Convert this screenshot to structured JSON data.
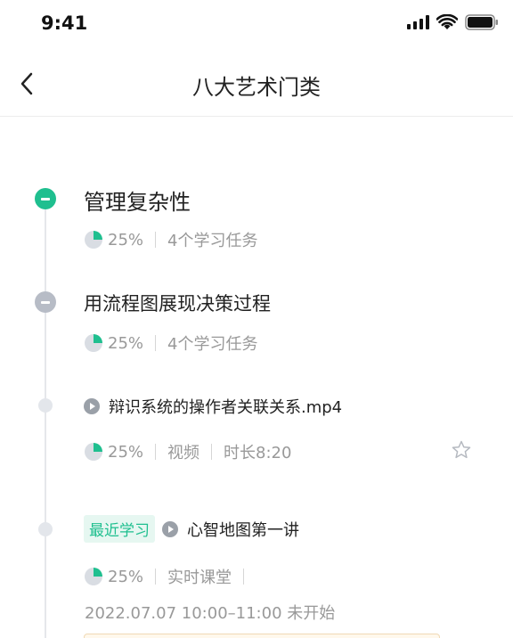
{
  "status": {
    "time": "9:41"
  },
  "nav": {
    "title": "八大艺术门类"
  },
  "sections": [
    {
      "title": "管理复杂性",
      "progress": "25%",
      "tasks": "4个学习任务"
    },
    {
      "title": "用流程图展现决策过程",
      "progress": "25%",
      "tasks": "4个学习任务"
    }
  ],
  "video": {
    "title": "辩识系统的操作者关联关系.mp4",
    "progress": "25%",
    "type": "视频",
    "duration": "时长8:20"
  },
  "live": {
    "badge": "最近学习",
    "title": "心智地图第一讲",
    "progress": "25%",
    "type": "实时课堂",
    "datetime": "2022.07.07 10:00–11:00 未开始"
  },
  "colors": {
    "accent": "#1fbf8f",
    "muted": "#999999"
  }
}
